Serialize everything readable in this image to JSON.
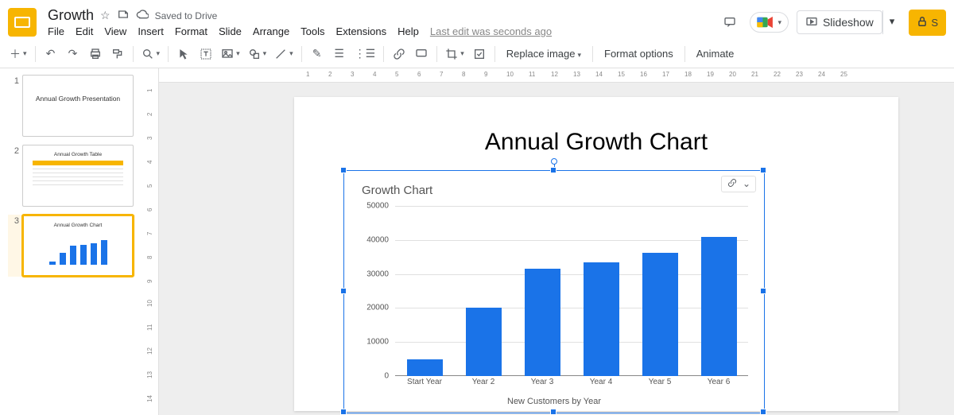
{
  "doc": {
    "title": "Growth",
    "save_status": "Saved to Drive",
    "last_edit": "Last edit was seconds ago"
  },
  "menus": [
    "File",
    "Edit",
    "View",
    "Insert",
    "Format",
    "Slide",
    "Arrange",
    "Tools",
    "Extensions",
    "Help"
  ],
  "title_actions": {
    "slideshow_label": "Slideshow",
    "share_label": "S"
  },
  "toolbar": {
    "replace_image": "Replace image",
    "format_options": "Format options",
    "animate": "Animate"
  },
  "filmstrip": {
    "slides": [
      {
        "num": "1",
        "title": "Annual Growth Presentation",
        "kind": "title",
        "selected": false
      },
      {
        "num": "2",
        "title": "Annual Growth Table",
        "kind": "table",
        "selected": false
      },
      {
        "num": "3",
        "title": "Annual Growth Chart",
        "kind": "chart",
        "selected": true
      }
    ]
  },
  "ruler_h": [
    "1",
    "2",
    "3",
    "4",
    "5",
    "6",
    "7",
    "8",
    "9",
    "10",
    "11",
    "12",
    "13",
    "14",
    "15",
    "16",
    "17",
    "18",
    "19",
    "20",
    "21",
    "22",
    "23",
    "24",
    "25"
  ],
  "ruler_v": [
    "1",
    "2",
    "3",
    "4",
    "5",
    "6",
    "7",
    "8",
    "9",
    "10",
    "11",
    "12",
    "13",
    "14"
  ],
  "slide": {
    "title": "Annual Growth Chart"
  },
  "chart_controls": {
    "link_icon": "link-icon",
    "open_icon": "chevron-down-icon"
  },
  "chart_data": {
    "type": "bar",
    "title": "Growth Chart",
    "xlabel": "New Customers by Year",
    "ylabel": "",
    "ylim": [
      0,
      50000
    ],
    "yticks": [
      0,
      10000,
      20000,
      30000,
      40000,
      50000
    ],
    "categories": [
      "Start Year",
      "Year 2",
      "Year 3",
      "Year 4",
      "Year 5",
      "Year 6"
    ],
    "values": [
      5000,
      20000,
      31500,
      33500,
      36200,
      41000
    ]
  }
}
